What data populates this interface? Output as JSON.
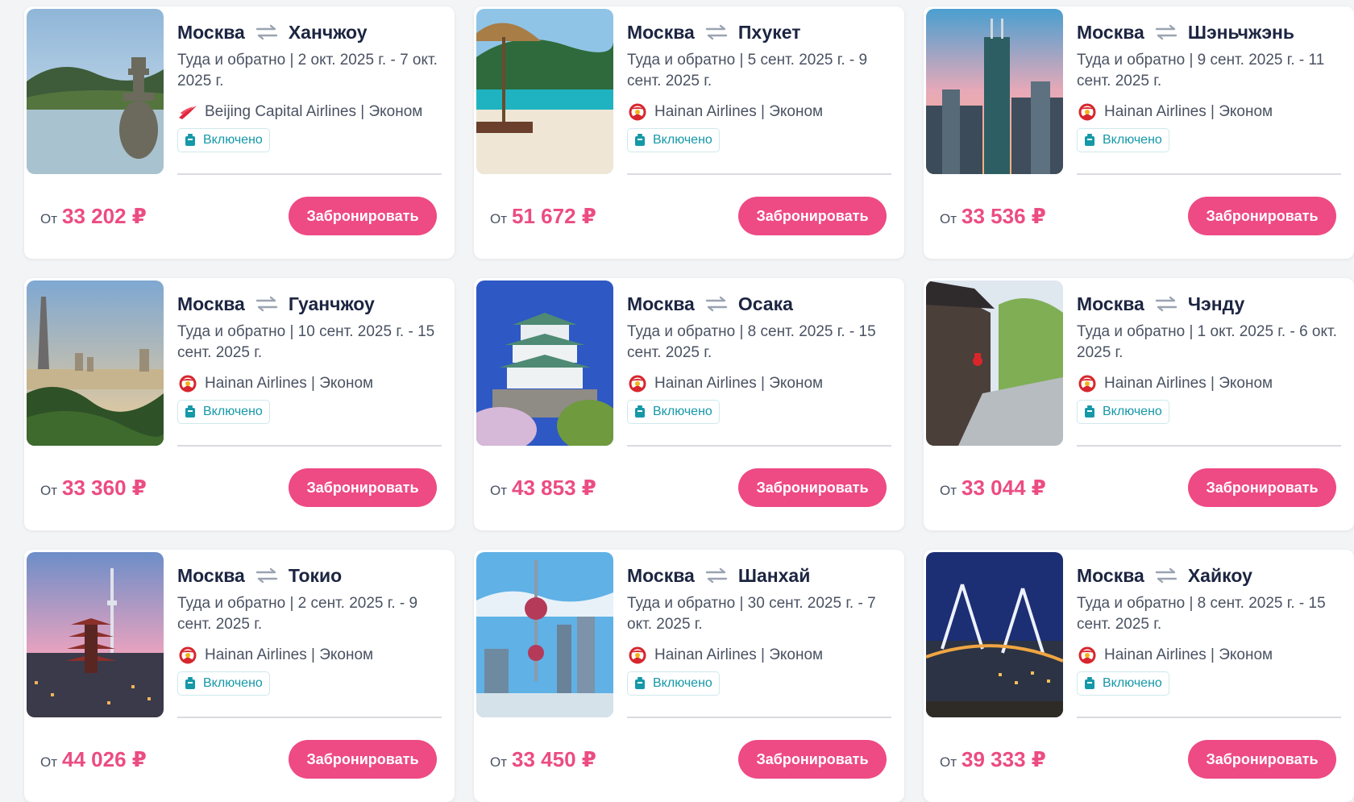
{
  "colors": {
    "accent": "#ee4a83",
    "price": "#ec4c82",
    "badge": "#1598a8",
    "title": "#1c2541",
    "text": "#4a5262"
  },
  "labels": {
    "from": "От",
    "book": "Забронировать",
    "baggage": "Включено"
  },
  "cards": [
    {
      "origin": "Москва",
      "destination": "Ханчжоу",
      "dates": "Туда и обратно | 2 окт. 2025 г. - 7 окт. 2025 г.",
      "airline": "Beijing Capital Airlines | Эконом",
      "airline_logo": "beijing-capital-logo-icon",
      "price": "33 202 ₽",
      "image": "hangzhou-lake-pagoda"
    },
    {
      "origin": "Москва",
      "destination": "Пхукет",
      "dates": "Туда и обратно | 5 сент. 2025 г. - 9 сент. 2025 г.",
      "airline": "Hainan Airlines | Эконом",
      "airline_logo": "hainan-airlines-logo-icon",
      "price": "51 672 ₽",
      "image": "phuket-beach-umbrella"
    },
    {
      "origin": "Москва",
      "destination": "Шэньчжэнь",
      "dates": "Туда и обратно | 9 сент. 2025 г. - 11 сент. 2025 г.",
      "airline": "Hainan Airlines | Эконом",
      "airline_logo": "hainan-airlines-logo-icon",
      "price": "33 536 ₽",
      "image": "shenzhen-skyscrapers"
    },
    {
      "origin": "Москва",
      "destination": "Гуанчжоу",
      "dates": "Туда и обратно | 10 сент. 2025 г. - 15 сент. 2025 г.",
      "airline": "Hainan Airlines | Эконом",
      "airline_logo": "hainan-airlines-logo-icon",
      "price": "33 360 ₽",
      "image": "guangzhou-canton-tower"
    },
    {
      "origin": "Москва",
      "destination": "Осака",
      "dates": "Туда и обратно | 8 сент. 2025 г. - 15 сент. 2025 г.",
      "airline": "Hainan Airlines | Эконом",
      "airline_logo": "hainan-airlines-logo-icon",
      "price": "43 853 ₽",
      "image": "osaka-castle"
    },
    {
      "origin": "Москва",
      "destination": "Чэнду",
      "dates": "Туда и обратно | 1 окт. 2025 г. - 6 окт. 2025 г.",
      "airline": "Hainan Airlines | Эконом",
      "airline_logo": "hainan-airlines-logo-icon",
      "price": "33 044 ₽",
      "image": "chengdu-street"
    },
    {
      "origin": "Москва",
      "destination": "Токио",
      "dates": "Туда и обратно | 2 сент. 2025 г. - 9 сент. 2025 г.",
      "airline": "Hainan Airlines | Эконом",
      "airline_logo": "hainan-airlines-logo-icon",
      "price": "44 026 ₽",
      "image": "tokyo-skytree-pagoda"
    },
    {
      "origin": "Москва",
      "destination": "Шанхай",
      "dates": "Туда и обратно | 30 сент. 2025 г. - 7 окт. 2025 г.",
      "airline": "Hainan Airlines | Эконом",
      "airline_logo": "hainan-airlines-logo-icon",
      "price": "33 450 ₽",
      "image": "shanghai-pearl-tower"
    },
    {
      "origin": "Москва",
      "destination": "Хайкоу",
      "dates": "Туда и обратно | 8 сент. 2025 г. - 15 сент. 2025 г.",
      "airline": "Hainan Airlines | Эконом",
      "airline_logo": "hainan-airlines-logo-icon",
      "price": "39 333 ₽",
      "image": "haikou-bridge-night"
    }
  ]
}
